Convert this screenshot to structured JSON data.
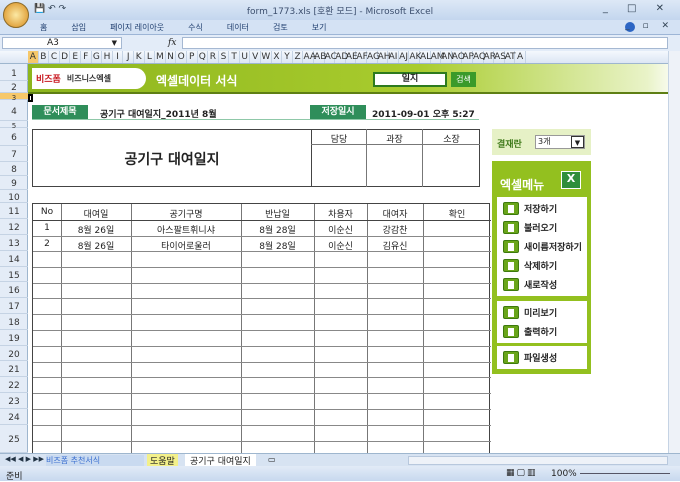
{
  "window": {
    "title": "form_1773.xls  [호환 모드] - Microsoft Excel"
  },
  "ribbon": {
    "tabs": [
      "홈",
      "삽입",
      "페이지 레이아웃",
      "수식",
      "데이터",
      "검토",
      "보기"
    ]
  },
  "formula_bar": {
    "name_box": "A3",
    "fx": "fx",
    "value": ""
  },
  "columns": [
    "A",
    "B",
    "C",
    "D",
    "E",
    "F",
    "G",
    "H",
    "I",
    "J",
    "K",
    "L",
    "M",
    "N",
    "O",
    "P",
    "Q",
    "R",
    "S",
    "T",
    "U",
    "V",
    "W",
    "X",
    "Y",
    "Z",
    "AA",
    "AB",
    "AC",
    "AD",
    "AE",
    "AF",
    "AG",
    "AH",
    "AI",
    "AJ",
    "AK",
    "AL",
    "AM",
    "AN",
    "AO",
    "AP",
    "AQ",
    "AR",
    "AS",
    "AT",
    "A"
  ],
  "rows": [
    "1",
    "2",
    "3",
    "4",
    "5",
    "6",
    "7",
    "8",
    "9",
    "10",
    "11",
    "12",
    "13",
    "14",
    "15",
    "16",
    "17",
    "18",
    "19",
    "20",
    "21",
    "22",
    "23",
    "24",
    "25"
  ],
  "banner": {
    "logo1": "비즈폼",
    "logo2": "비즈니스엑셀",
    "title": "엑셀데이터 서식",
    "search_value": "일지",
    "search_button": "검색"
  },
  "doc": {
    "title_label": "문서제목",
    "title_value": "공기구 대여일지_2011년 8월",
    "saved_label": "저장일시",
    "saved_value": "2011-09-01  오후 5:27",
    "heading": "공기구 대여일지",
    "approvals": [
      "담당",
      "과장",
      "소장"
    ]
  },
  "table": {
    "headers": [
      "No",
      "대여일",
      "공기구명",
      "반납일",
      "차용자",
      "대여자",
      "확인"
    ],
    "rows": [
      [
        "1",
        "8월 26일",
        "아스팔트휘니샤",
        "8월 28일",
        "이순신",
        "강감찬",
        ""
      ],
      [
        "2",
        "8월 26일",
        "타이어로울러",
        "8월 28일",
        "이순신",
        "김유신",
        ""
      ]
    ]
  },
  "panel": {
    "approval_label": "결재란",
    "approval_value": "3개",
    "menu_title": "엑셀메뉴",
    "group1": [
      "저장하기",
      "불러오기",
      "새이름저장하기",
      "삭제하기",
      "새로작성"
    ],
    "group2": [
      "미리보기",
      "출력하기"
    ],
    "group3": [
      "파일생성"
    ]
  },
  "sheet_tabs": [
    "비즈폼 추천서식",
    "도움말",
    "공기구 대여일지"
  ],
  "status": {
    "ready": "준비",
    "zoom": "100%"
  }
}
